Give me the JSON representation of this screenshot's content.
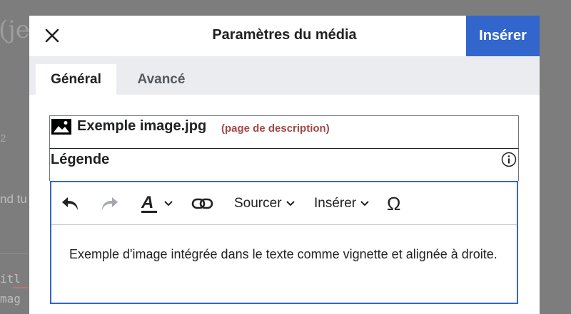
{
  "background": {
    "title_fragment": "(je",
    "small_fragment": "2",
    "text_fragment": "nd tu",
    "code_line_1": "itl",
    "code_line_2": "mag"
  },
  "dialog": {
    "title": "Paramètres du média",
    "primary_action": "Insérer",
    "tabs": [
      {
        "label": "Général",
        "active": true
      },
      {
        "label": "Avancé",
        "active": false
      }
    ],
    "media": {
      "filename": "Exemple image.jpg",
      "description_link": "(page de description)"
    },
    "caption": {
      "label": "Légende",
      "toolbar": {
        "cite_label": "Sourcer",
        "insert_label": "Insérer",
        "special_char": "Ω"
      },
      "text": "Exemple d'image intégrée dans le texte comme vignette et alignée à droite."
    }
  },
  "colors": {
    "accent": "#3366cc",
    "link_visited": "#a14945",
    "overlay": "#7d7d7d"
  },
  "icons": [
    "close-icon",
    "image-icon",
    "info-icon",
    "undo-icon",
    "redo-icon",
    "text-style-icon",
    "link-icon",
    "chevron-down-icon"
  ]
}
